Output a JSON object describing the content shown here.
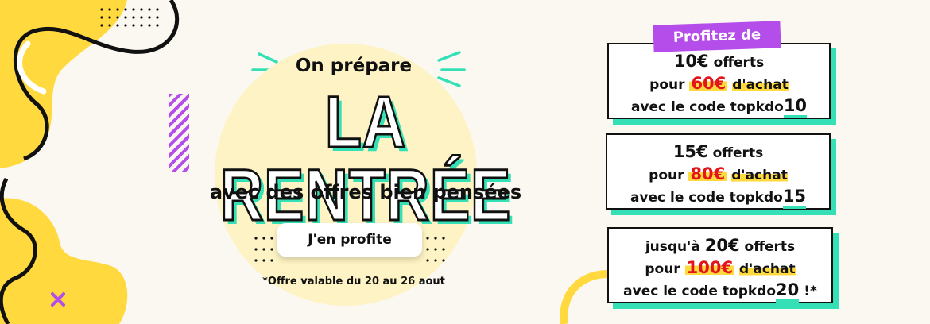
{
  "hero": {
    "kicker": "On prépare",
    "title": "LA RENTRÉE",
    "subtitle": "avec des offres bien pensées",
    "cta_label": "J'en profite",
    "footnote": "*Offre valable du 20 au 26 aout"
  },
  "promo": {
    "ribbon": "Profitez de",
    "offers": [
      {
        "lead": "",
        "amount": "10€",
        "offered": "offerts",
        "for": "pour",
        "min": "60€",
        "purchase": "d'achat",
        "code_text": "avec le code",
        "code_prefix": "topkdo",
        "code_num": "10",
        "suffix": ""
      },
      {
        "lead": "",
        "amount": "15€",
        "offered": "offerts",
        "for": "pour",
        "min": "80€",
        "purchase": "d'achat",
        "code_text": "avec le code",
        "code_prefix": "topkdo",
        "code_num": "15",
        "suffix": ""
      },
      {
        "lead": "jusqu'à",
        "amount": "20€",
        "offered": "offerts",
        "for": "pour",
        "min": "100€",
        "purchase": "d'achat",
        "code_text": "avec le code",
        "code_prefix": "topkdo",
        "code_num": "20",
        "suffix": "!*"
      }
    ]
  },
  "colors": {
    "background": "#fbf8f1",
    "yellow": "#ffd93d",
    "mint": "#35e0b6",
    "purple": "#b54dea",
    "red": "#e3151a",
    "ink": "#111111"
  }
}
